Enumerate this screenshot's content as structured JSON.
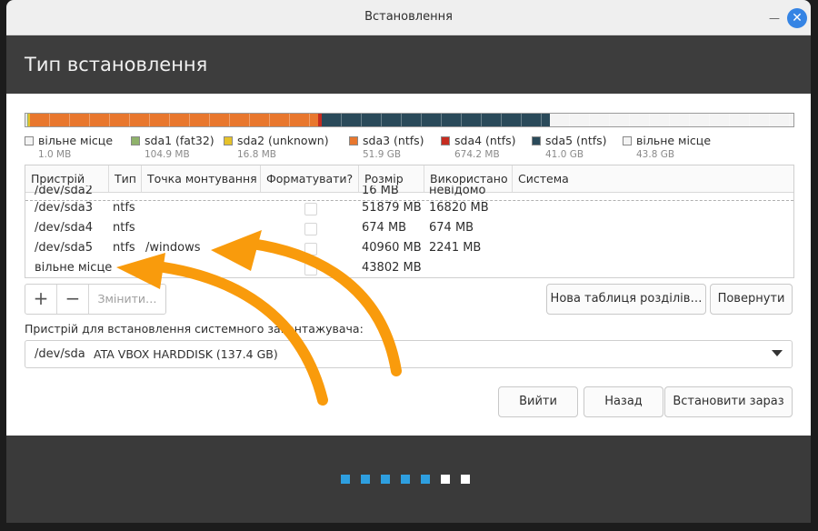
{
  "window": {
    "title": "Встановлення"
  },
  "page": {
    "title": "Тип встановлення"
  },
  "colors": {
    "accent": "#3584e4",
    "arrow": "#f99b0c"
  },
  "partition_bar": [
    {
      "name": "вільне місце",
      "color": "#e6e6e6",
      "size_mb": 1.0
    },
    {
      "name": "sda1 (fat32)",
      "color": "#8fb26b",
      "size_mb": 104.9
    },
    {
      "name": "sda2 (unknown)",
      "color": "#e6c22a",
      "size_mb": 16.8
    },
    {
      "name": "sda3 (ntfs)",
      "color": "#e8772e",
      "size_mb": 51900
    },
    {
      "name": "sda4 (ntfs)",
      "color": "#c62c20",
      "size_mb": 674.2
    },
    {
      "name": "sda5 (ntfs)",
      "color": "#2a4a5a",
      "size_mb": 41000
    },
    {
      "name": "вільне місце",
      "color": "#f4f4f4",
      "size_mb": 43800
    }
  ],
  "legend": [
    {
      "name": "вільне місце",
      "size": "1.0 MB",
      "color": "#f4f4f4"
    },
    {
      "name": "sda1 (fat32)",
      "size": "104.9 MB",
      "color": "#8fb26b"
    },
    {
      "name": "sda2 (unknown)",
      "size": "16.8 MB",
      "color": "#e6c22a"
    },
    {
      "name": "sda3 (ntfs)",
      "size": "51.9 GB",
      "color": "#e8772e"
    },
    {
      "name": "sda4 (ntfs)",
      "size": "674.2 MB",
      "color": "#c62c20"
    },
    {
      "name": "sda5 (ntfs)",
      "size": "41.0 GB",
      "color": "#2a4a5a"
    },
    {
      "name": "вільне місце",
      "size": "43.8 GB",
      "color": "#f4f4f4"
    }
  ],
  "table": {
    "headers": [
      "Пристрій",
      "Тип",
      "Точка монтування",
      "Форматувати?",
      "Розмір",
      "Використано",
      "Система"
    ],
    "partial_row": {
      "device": "/dev/sda2",
      "size": "16 MB",
      "used": "невідомо"
    },
    "rows": [
      {
        "device": "/dev/sda3",
        "type": "ntfs",
        "mount": "",
        "size": "51879 MB",
        "used": "16820 MB"
      },
      {
        "device": "/dev/sda4",
        "type": "ntfs",
        "mount": "",
        "size": "674 MB",
        "used": "674 MB"
      },
      {
        "device": "/dev/sda5",
        "type": "ntfs",
        "mount": "/windows",
        "size": "40960 MB",
        "used": "2241 MB"
      },
      {
        "device": "вільне місце",
        "type": "",
        "mount": "",
        "size": "43802 MB",
        "used": ""
      }
    ]
  },
  "toolbar": {
    "add": "+",
    "remove": "−",
    "change": "Змінити…"
  },
  "buttons": {
    "new_table": "Нова таблиця розділів…",
    "revert": "Повернути",
    "quit": "Вийти",
    "back": "Назад",
    "install": "Встановити зараз"
  },
  "bootloader": {
    "label": "Пристрій для встановлення системного завантажувача:",
    "device": "/dev/sda",
    "description": "ATA VBOX HARDDISK (137.4 GB)"
  },
  "progress_dots": {
    "total": 7,
    "completed": 5,
    "done_color": "#2e9fe0",
    "pending_color": "#ffffff"
  }
}
